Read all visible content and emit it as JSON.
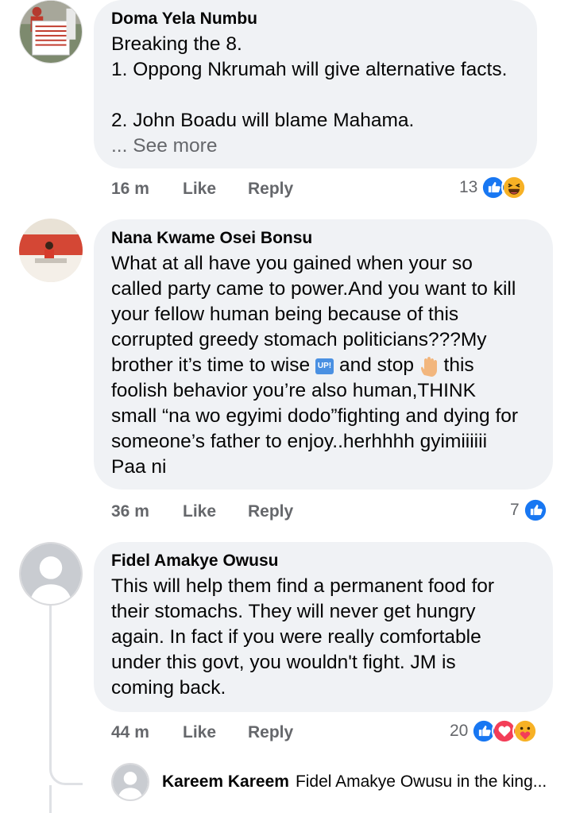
{
  "comments": [
    {
      "author": "Doma Yela Numbu",
      "text": "Breaking the 8.\n1. Oppong Nkrumah will give alternative facts.\n\n2. John Boadu will blame Mahama.",
      "see_more": "... See more",
      "time": "16 m",
      "like": "Like",
      "reply": "Reply",
      "reaction_count": "13",
      "reactions": [
        "like-icon",
        "haha-icon"
      ]
    },
    {
      "author": "Nana Kwame Osei Bonsu",
      "text_a": "What at all have you gained when your so\ncalled party came to power.And you want to kill\nyour fellow human being because of this\ncorrupted greedy stomach politicians???My\nbrother it’s time to wise ",
      "text_b": " and stop ",
      "text_c": " this\nfoolish behavior you’re also human,THINK\nsmall “na wo egyimi dodo”fighting and dying for\nsomeone’s father to enjoy..herhhhh gyimiiiiii\nPaa ni",
      "up_emoji_label": "UP!",
      "time": "36 m",
      "like": "Like",
      "reply": "Reply",
      "reaction_count": "7",
      "reactions": [
        "like-icon"
      ]
    },
    {
      "author": "Fidel Amakye Owusu",
      "text": "This will help them find a permanent food for\ntheir stomachs. They will never get hungry\nagain. In fact if you were really comfortable\nunder this govt, you wouldn't fight. JM is\ncoming back.",
      "time": "44 m",
      "like": "Like",
      "reply": "Reply",
      "reaction_count": "20",
      "reactions": [
        "like-icon",
        "love-icon",
        "care-icon"
      ]
    }
  ],
  "reply": {
    "author": "Kareem Kareem",
    "text": "Fidel Amakye Owusu in the king..."
  },
  "colors": {
    "bubble": "#f0f2f5",
    "meta": "#65676b",
    "like_blue": "#1877f2",
    "love_red": "#f33e58",
    "haha_yellow": "#f7b125",
    "up_blue": "#4a90e2"
  }
}
